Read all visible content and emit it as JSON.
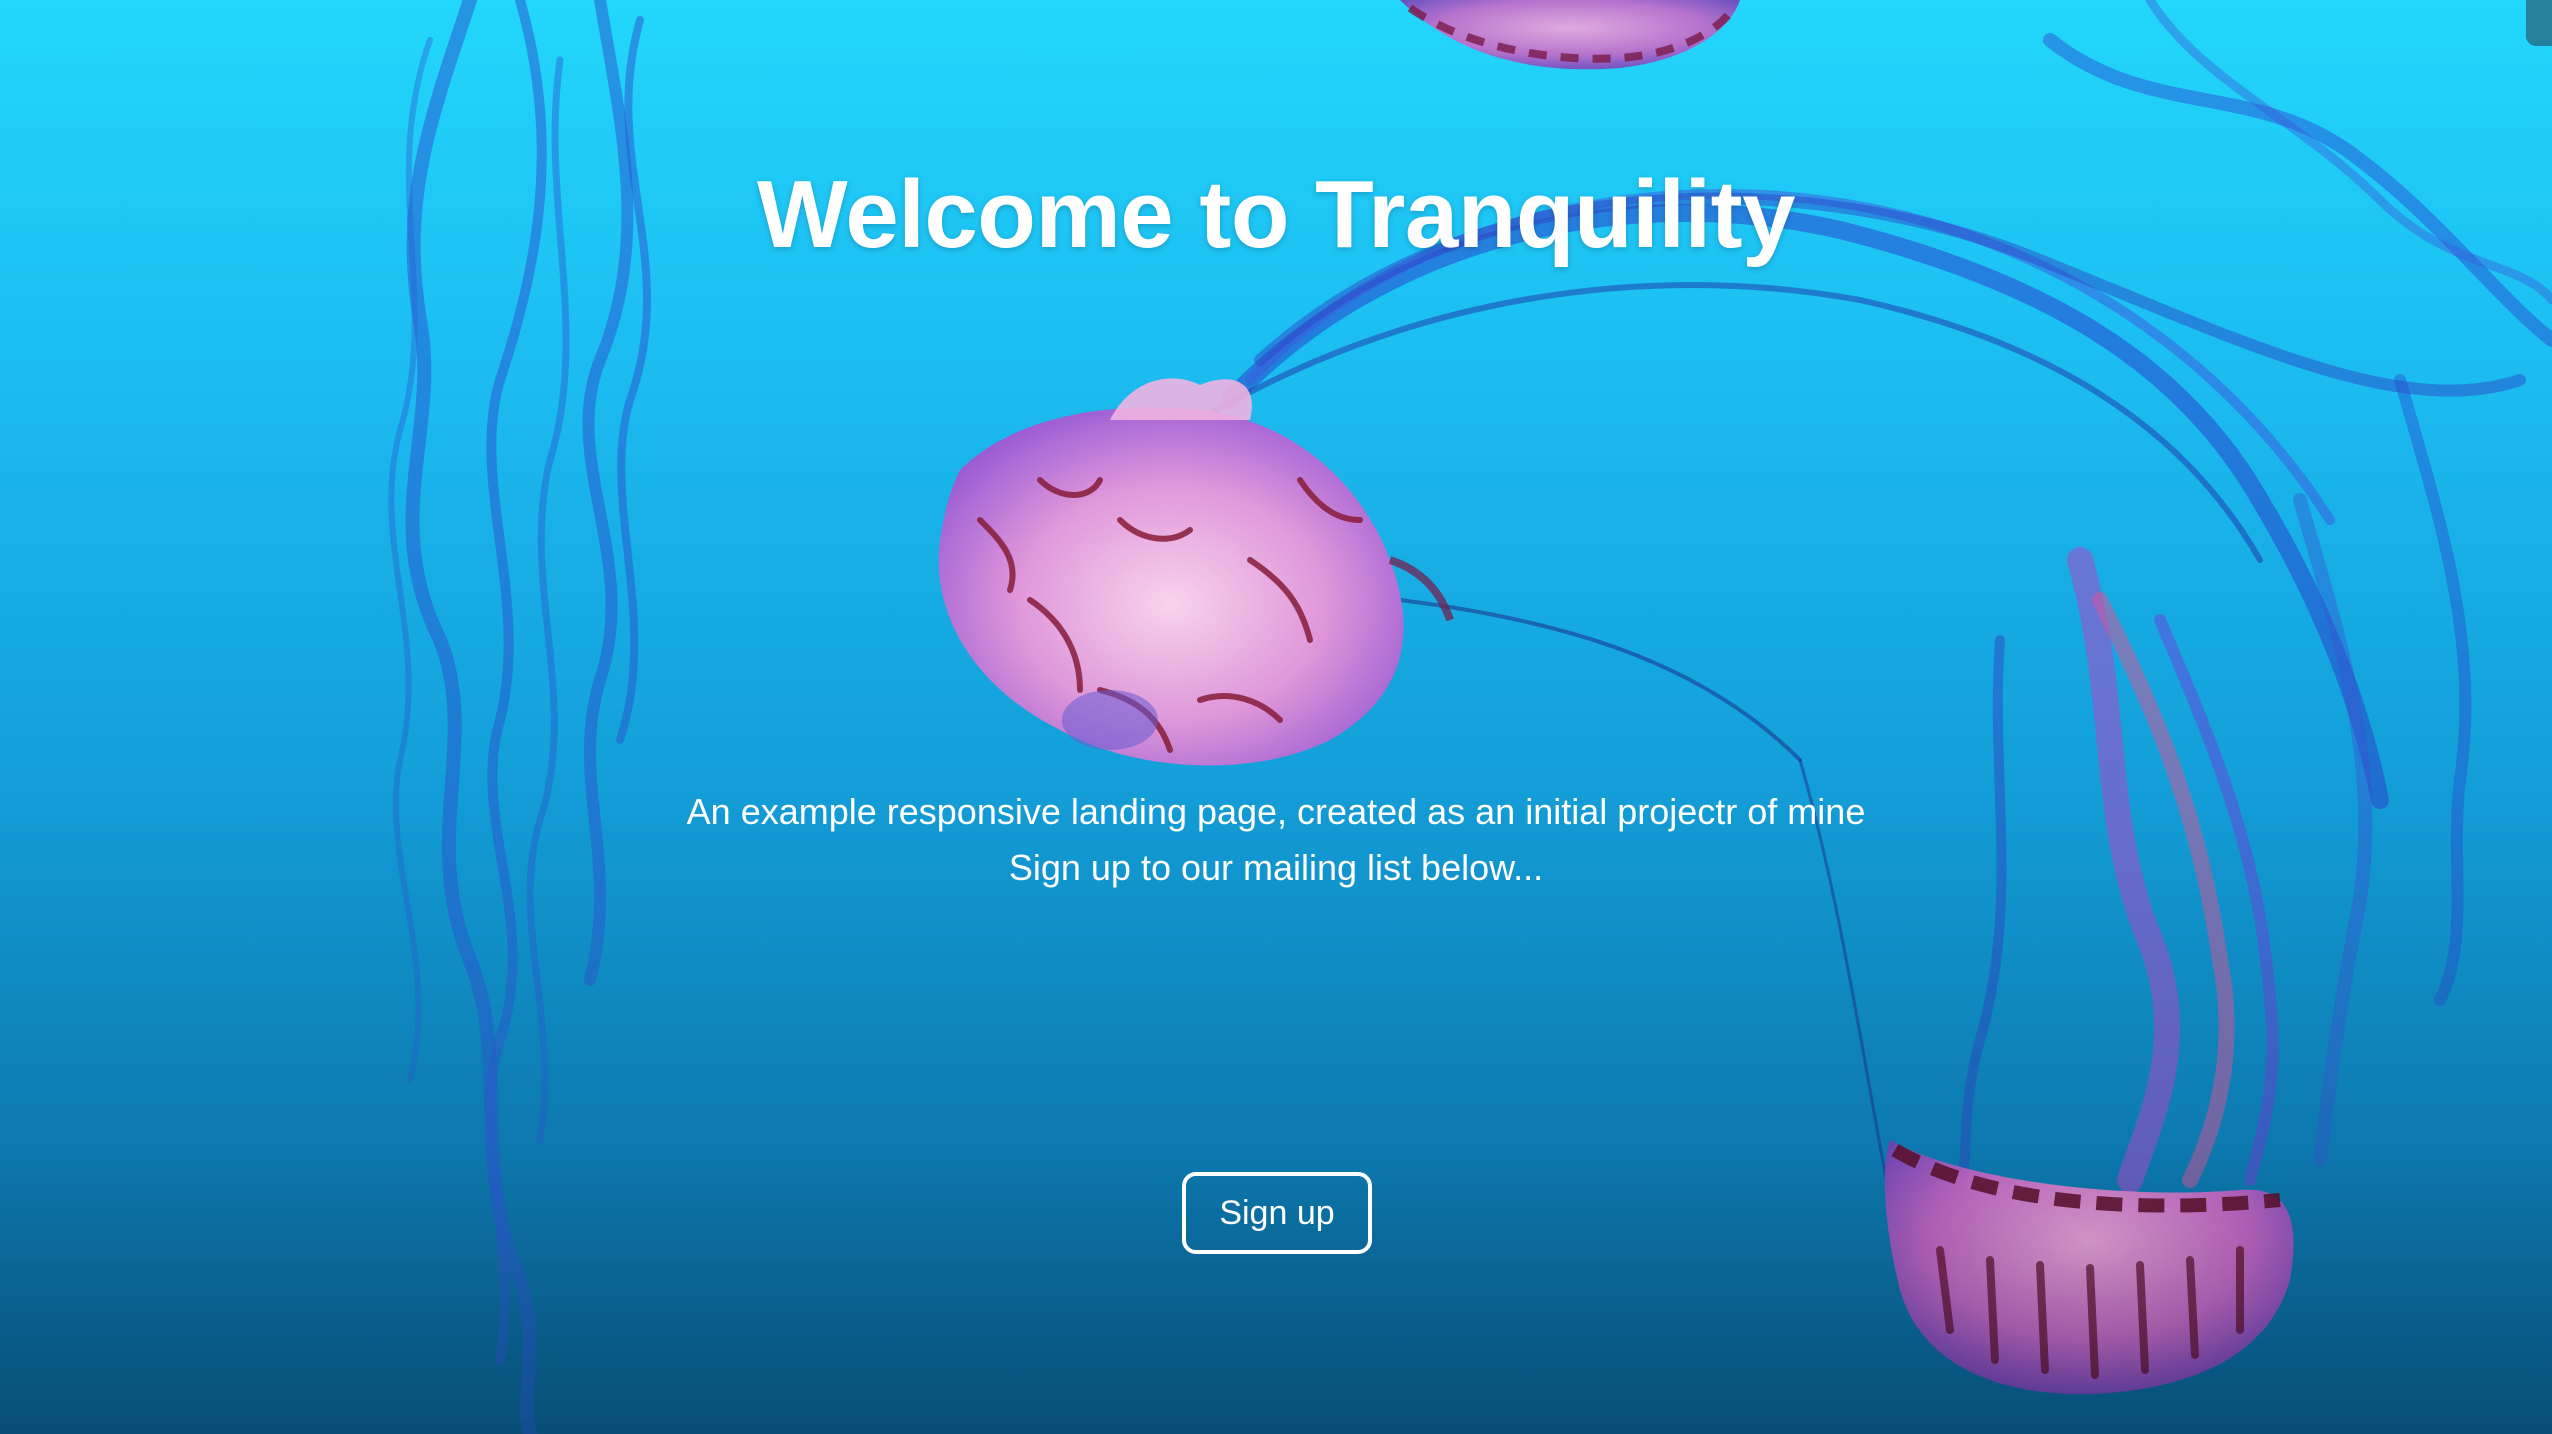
{
  "hero": {
    "title": "Welcome to Tranquility",
    "subtitle_line1": "An example responsive landing page, created as an initial projectr of mine",
    "subtitle_line2": "Sign up to our mailing list below...",
    "signup_label": "Sign up"
  },
  "colors": {
    "background_top": "#23d6fb",
    "background_bottom": "#0a6496",
    "text": "#ffffff",
    "jellyfish_bell": "#f0a8e0",
    "jellyfish_markings": "#8a1d3a",
    "tentacles": "#2e4fd8"
  }
}
